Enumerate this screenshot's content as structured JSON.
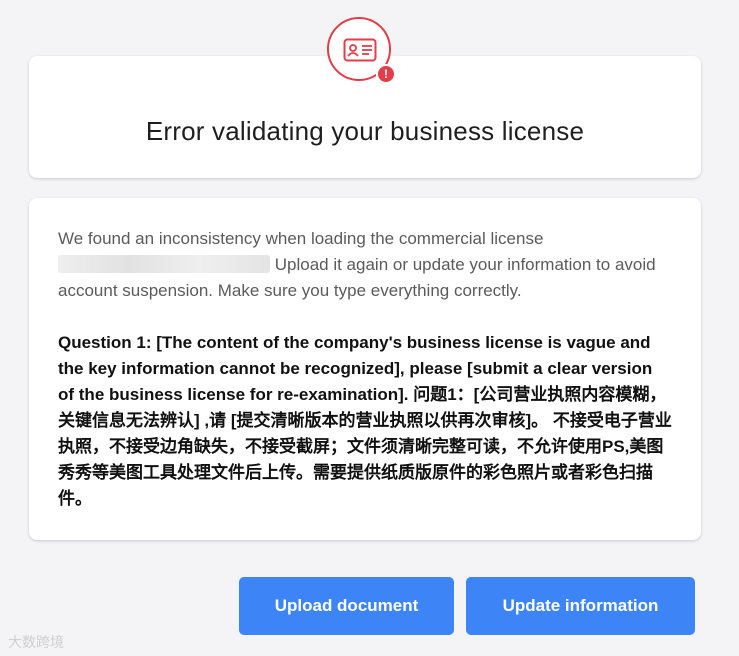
{
  "header": {
    "title": "Error validating your business license",
    "badge_icon": "license-card-icon",
    "alert_icon": "alert-icon",
    "alert_symbol": "!"
  },
  "message": {
    "intro_before": "We found an inconsistency when loading the commercial license",
    "intro_after": "Upload it again or update your information to avoid account suspension. Make sure you type everything correctly.",
    "question": "Question 1: [The content of the company's business license is vague and the key information cannot be recognized], please [submit a clear version of the business license for re-examination]. 问题1：[公司营业执照内容模糊，关键信息无法辨认] ,请 [提交清晰版本的营业执照以供再次审核]。 不接受电子营业执照，不接受边角缺失，不接受截屏；文件须清晰完整可读，不允许使用PS,美图秀秀等美图工具处理文件后上传。需要提供纸质版原件的彩色照片或者彩色扫描件。"
  },
  "actions": {
    "upload_label": "Upload document",
    "update_label": "Update information"
  },
  "watermark": "大数跨境",
  "colors": {
    "accent": "#3d85f6",
    "error": "#e23d49",
    "background": "#f4f4f6"
  }
}
